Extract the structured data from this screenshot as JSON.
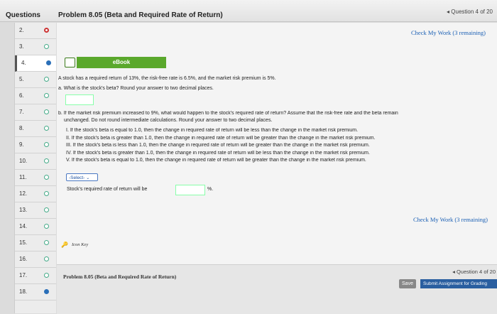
{
  "header": {
    "questions_label": "Questions",
    "problem_title": "Problem 8.05 (Beta and Required Rate of Return)",
    "question_counter": "◂ Question 4 of 20"
  },
  "questions": [
    {
      "num": "2.",
      "status": "red"
    },
    {
      "num": "3.",
      "status": "open"
    },
    {
      "num": "4.",
      "status": "filled"
    },
    {
      "num": "5.",
      "status": "open"
    },
    {
      "num": "6.",
      "status": "open"
    },
    {
      "num": "7.",
      "status": "open"
    },
    {
      "num": "8.",
      "status": "open"
    },
    {
      "num": "9.",
      "status": "open"
    },
    {
      "num": "10.",
      "status": "open"
    },
    {
      "num": "11.",
      "status": "open"
    },
    {
      "num": "12.",
      "status": "open"
    },
    {
      "num": "13.",
      "status": "open"
    },
    {
      "num": "14.",
      "status": "open"
    },
    {
      "num": "15.",
      "status": "open"
    },
    {
      "num": "16.",
      "status": "open"
    },
    {
      "num": "17.",
      "status": "open"
    },
    {
      "num": "18.",
      "status": "filled"
    }
  ],
  "check_work_top": "Check My Work (3 remaining)",
  "check_work_bottom": "Check My Work (3 remaining)",
  "ebook_label": "eBook",
  "problem": {
    "intro": "A stock has a required return of 13%, the risk-free rate is 6.5%, and the market risk premium is 5%.",
    "part_a": "a. What is the stock's beta? Round your answer to two decimal places.",
    "part_b_line1": "b. If the market risk premium increased to 9%, what would happen to the stock's required rate of return? Assume that the risk-free rate and the beta remain",
    "part_b_line2": "unchanged. Do not round intermediate calculations. Round your answer to two decimal places.",
    "options": [
      "I. If the stock's beta is equal to 1.0, then the change in required rate of return will be less than the change in the market risk premium.",
      "II. If the stock's beta is greater than 1.0, then the change in required rate of return will be greater than the change in the market risk premium.",
      "III. If the stock's beta is less than 1.0, then the change in required rate of return will be greater than the change in the market risk premium.",
      "IV. If the stock's beta is greater than 1.0, then the change in required rate of return will be less than the change in the market risk premium.",
      "V. If the stock's beta is equal to 1.0, then the change in required rate of return will be greater than the change in the market risk premium."
    ],
    "select_label": "-Select-",
    "rate_label": "Stock's required rate of return will be",
    "pct": "%."
  },
  "icon_key": "Icon Key",
  "footer": {
    "title": "Problem 8.05 (Beta and Required Rate of Return)",
    "counter": "◂ Question 4 of 20",
    "save": "Save",
    "submit": "Submit Assignment for Grading"
  }
}
